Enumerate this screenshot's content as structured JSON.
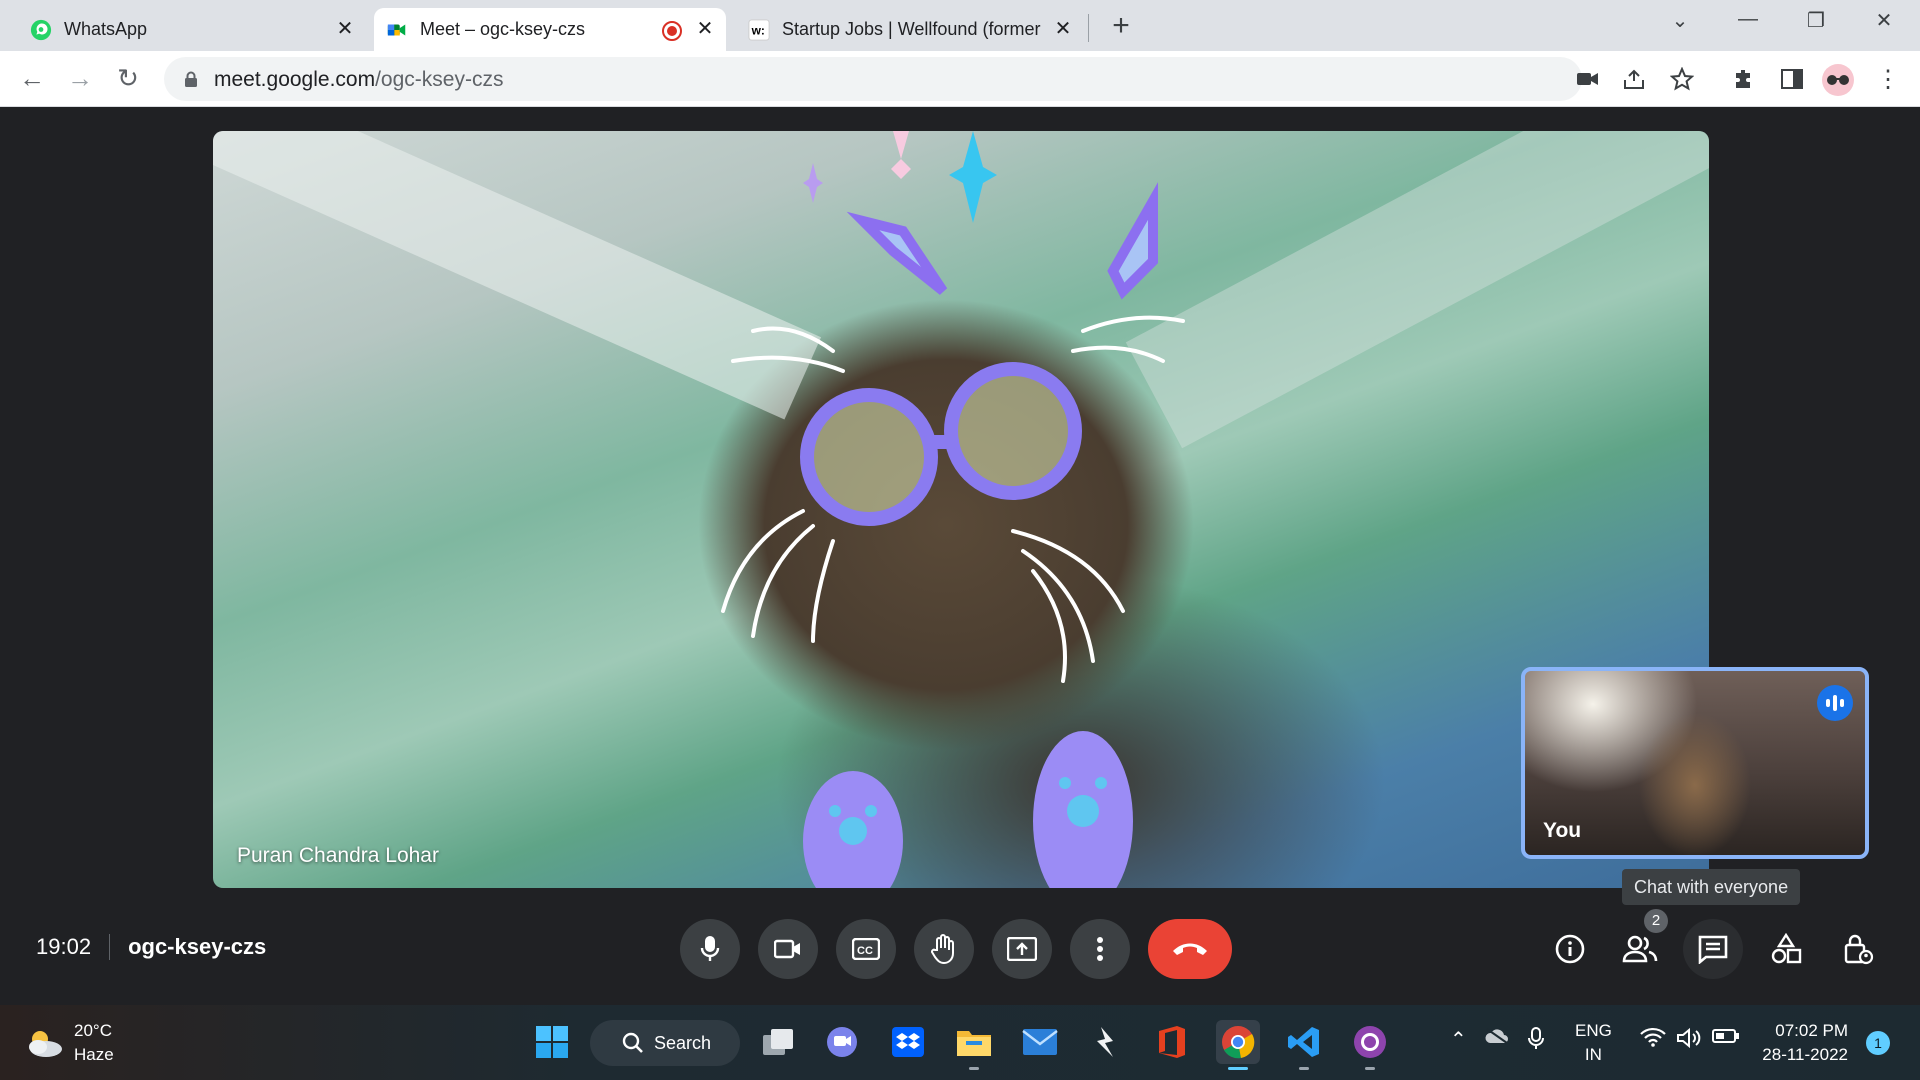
{
  "browser": {
    "tabs": [
      {
        "title": "WhatsApp",
        "favicon": "whatsapp-icon",
        "active": false
      },
      {
        "title": "Meet – ogc-ksey-czs",
        "favicon": "google-meet-icon",
        "active": true,
        "recording": true
      },
      {
        "title": "Startup Jobs | Wellfound (former",
        "favicon": "wellfound-icon",
        "active": false
      }
    ],
    "address": {
      "host": "meet.google.com",
      "path": "/ogc-ksey-czs"
    }
  },
  "meet": {
    "main_participant": "Puran Chandra Lohar",
    "self_label": "You",
    "tooltip": "Chat with everyone",
    "time": "19:02",
    "meeting_code": "ogc-ksey-czs",
    "participant_count": "2"
  },
  "taskbar": {
    "weather": {
      "temp": "20°C",
      "condition": "Haze"
    },
    "search_label": "Search",
    "lang": {
      "line1": "ENG",
      "line2": "IN"
    },
    "clock": {
      "time": "07:02 PM",
      "date": "28-11-2022"
    },
    "notifications": "1"
  },
  "colors": {
    "accent": "#1a73e8",
    "hangup": "#ea4335",
    "self_border": "#8ab4f8",
    "meet_bg": "#202124"
  }
}
